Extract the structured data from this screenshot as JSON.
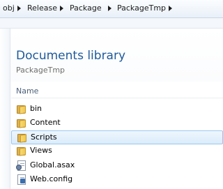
{
  "address_bar": {
    "crumbs": [
      "obj",
      "Release",
      "Package",
      "PackageTmp"
    ]
  },
  "library": {
    "title": "Documents library",
    "subtitle": "PackageTmp"
  },
  "file_list": {
    "column_header": "Name",
    "items": [
      {
        "name": "bin",
        "type": "folder"
      },
      {
        "name": "Content",
        "type": "folder"
      },
      {
        "name": "Scripts",
        "type": "folder",
        "selected": true
      },
      {
        "name": "Views",
        "type": "folder"
      },
      {
        "name": "Global.asax",
        "type": "file"
      },
      {
        "name": "Web.config",
        "type": "file"
      }
    ]
  }
}
